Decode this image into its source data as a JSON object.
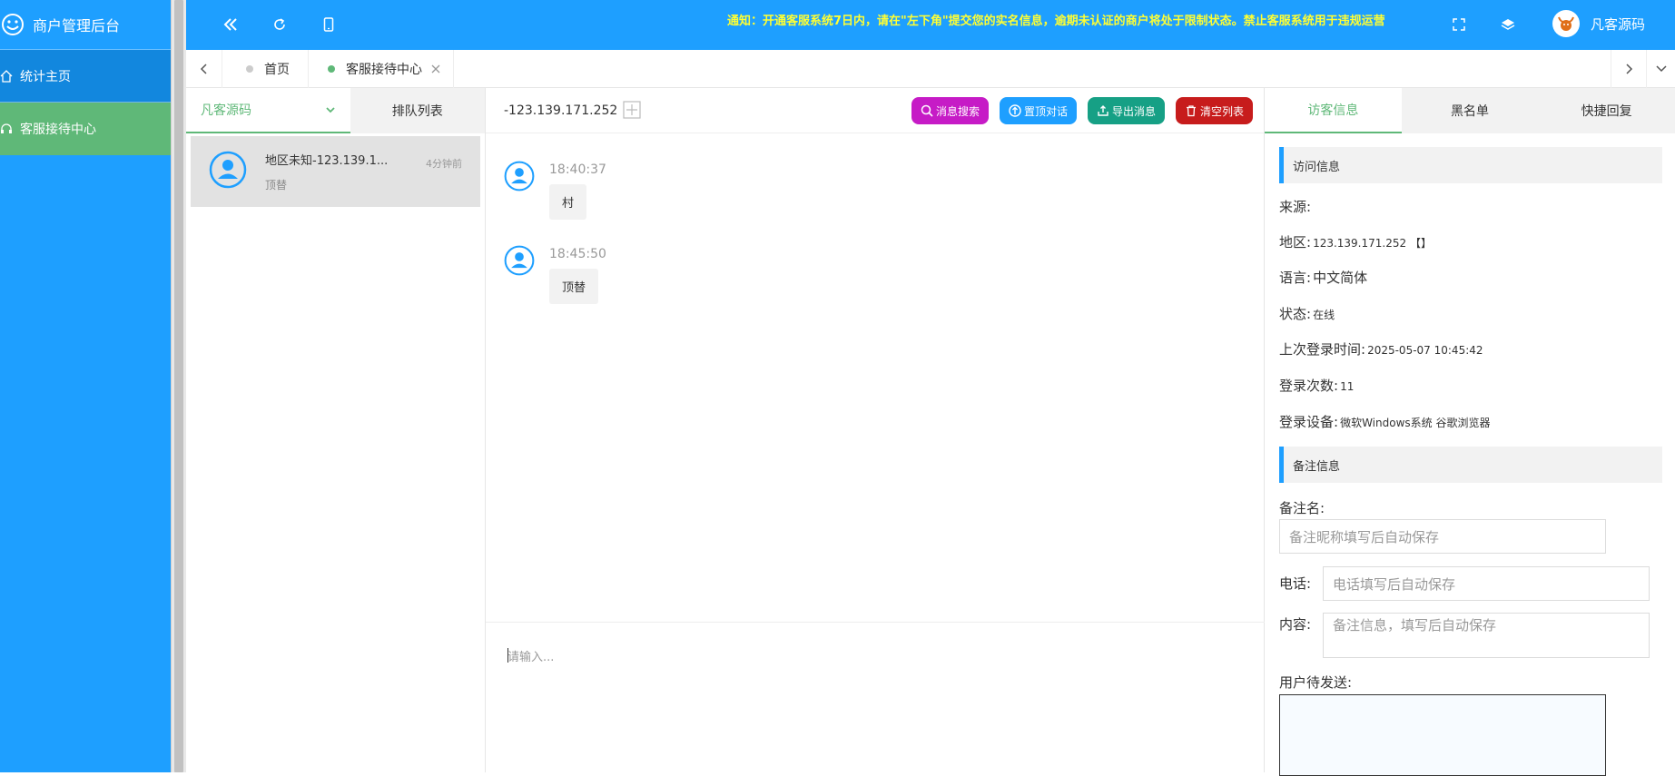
{
  "app": {
    "title": "商户管理后台",
    "brand_color": "#1e9fff",
    "active_color": "#5fb878"
  },
  "sidebar": {
    "items": [
      {
        "label": "统计主页",
        "icon": "home-icon"
      },
      {
        "label": "客服接待中心",
        "icon": "headset-icon"
      }
    ]
  },
  "topbar": {
    "notice": "通知：开通客服系统7日内，请在\"左下角\"提交您的实名信息，逾期未认证的商户将处于限制状态。禁止客服系统用于违规运营",
    "user_name": "凡客源码"
  },
  "tabs": [
    {
      "label": "首页",
      "dot_color": "#cccccc"
    },
    {
      "label": "客服接待中心",
      "dot_color": "#5fb878"
    }
  ],
  "visitor_panel": {
    "tab_group": "凡客源码",
    "tab_queue": "排队列表",
    "visitors": [
      {
        "title": "地区未知-123.139.1...",
        "subtitle": "顶替",
        "time": "4分钟前"
      }
    ]
  },
  "chat": {
    "ip": "-123.139.171.252",
    "buttons": {
      "search": "消息搜索",
      "pin": "置顶对话",
      "export": "导出消息",
      "clear": "清空列表"
    },
    "button_colors": {
      "search": "#c61bc6",
      "pin": "#1e9fff",
      "export": "#16a085",
      "clear": "#c71c1c"
    },
    "messages": [
      {
        "time": "18:40:37",
        "text": "村"
      },
      {
        "time": "18:45:50",
        "text": "顶替"
      }
    ],
    "input_placeholder": "请输入..."
  },
  "info_panel": {
    "tabs": [
      "访客信息",
      "黑名单",
      "快捷回复"
    ],
    "section_visit": "访问信息",
    "rows": {
      "source_label": "来源:",
      "source_value": "",
      "region_label": "地区:",
      "region_value": "123.139.171.252 【】",
      "language_label": "语言:",
      "language_value": "中文简体",
      "status_label": "状态:",
      "status_value": "在线",
      "last_login_label": "上次登录时间:",
      "last_login_value": "2025-05-07 10:45:42",
      "login_count_label": "登录次数:",
      "login_count_value": "11",
      "device_label": "登录设备:",
      "device_value": "微软Windows系统 谷歌浏览器"
    },
    "section_note": "备注信息",
    "note_name_label": "备注名:",
    "note_name_placeholder": "备注昵称填写后自动保存",
    "phone_label": "电话:",
    "phone_placeholder": "电话填写后自动保存",
    "content_label": "内容:",
    "content_placeholder": "备注信息，填写后自动保存",
    "pending_label": "用户待发送:"
  }
}
